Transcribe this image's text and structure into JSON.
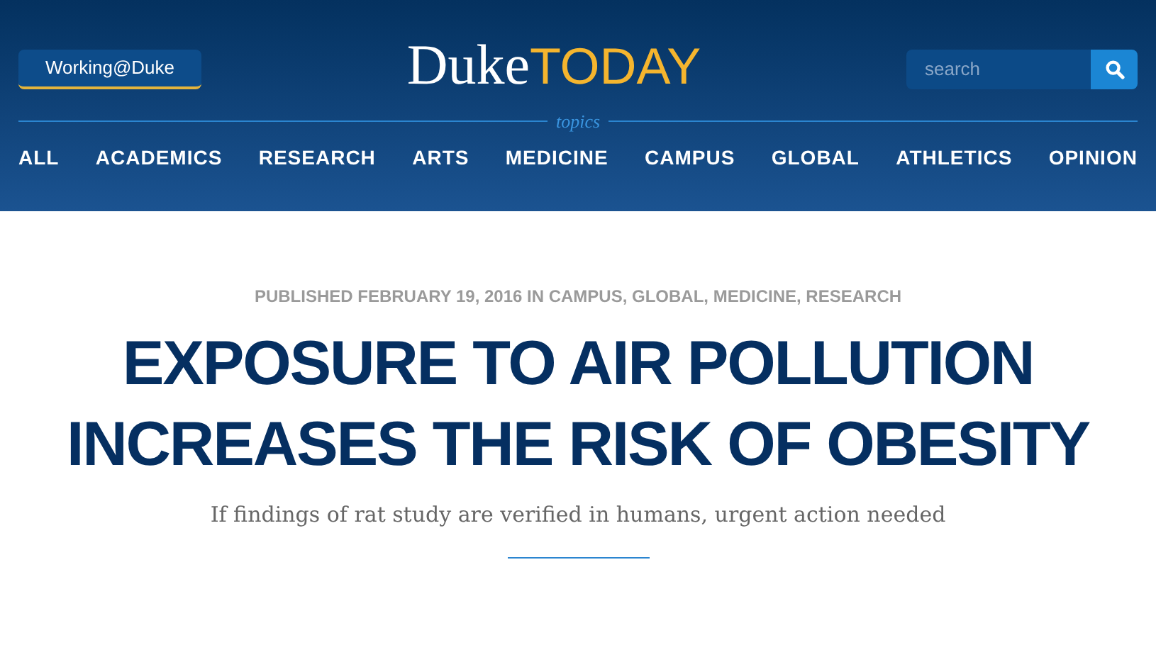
{
  "header": {
    "working_button": "Working@Duke",
    "logo": {
      "part_1": "Duke",
      "part_2": "TODAY"
    },
    "search": {
      "placeholder": "search"
    },
    "topics_label": "topics",
    "nav": [
      "ALL",
      "ACADEMICS",
      "RESEARCH",
      "ARTS",
      "MEDICINE",
      "CAMPUS",
      "GLOBAL",
      "ATHLETICS",
      "OPINION"
    ]
  },
  "article": {
    "meta": "PUBLISHED FEBRUARY 19, 2016 IN CAMPUS, GLOBAL, MEDICINE, RESEARCH",
    "title": "EXPOSURE TO AIR POLLUTION INCREASES THE RISK OF OBESITY",
    "subtitle": "If findings of rat study are verified in humans, urgent action needed"
  }
}
